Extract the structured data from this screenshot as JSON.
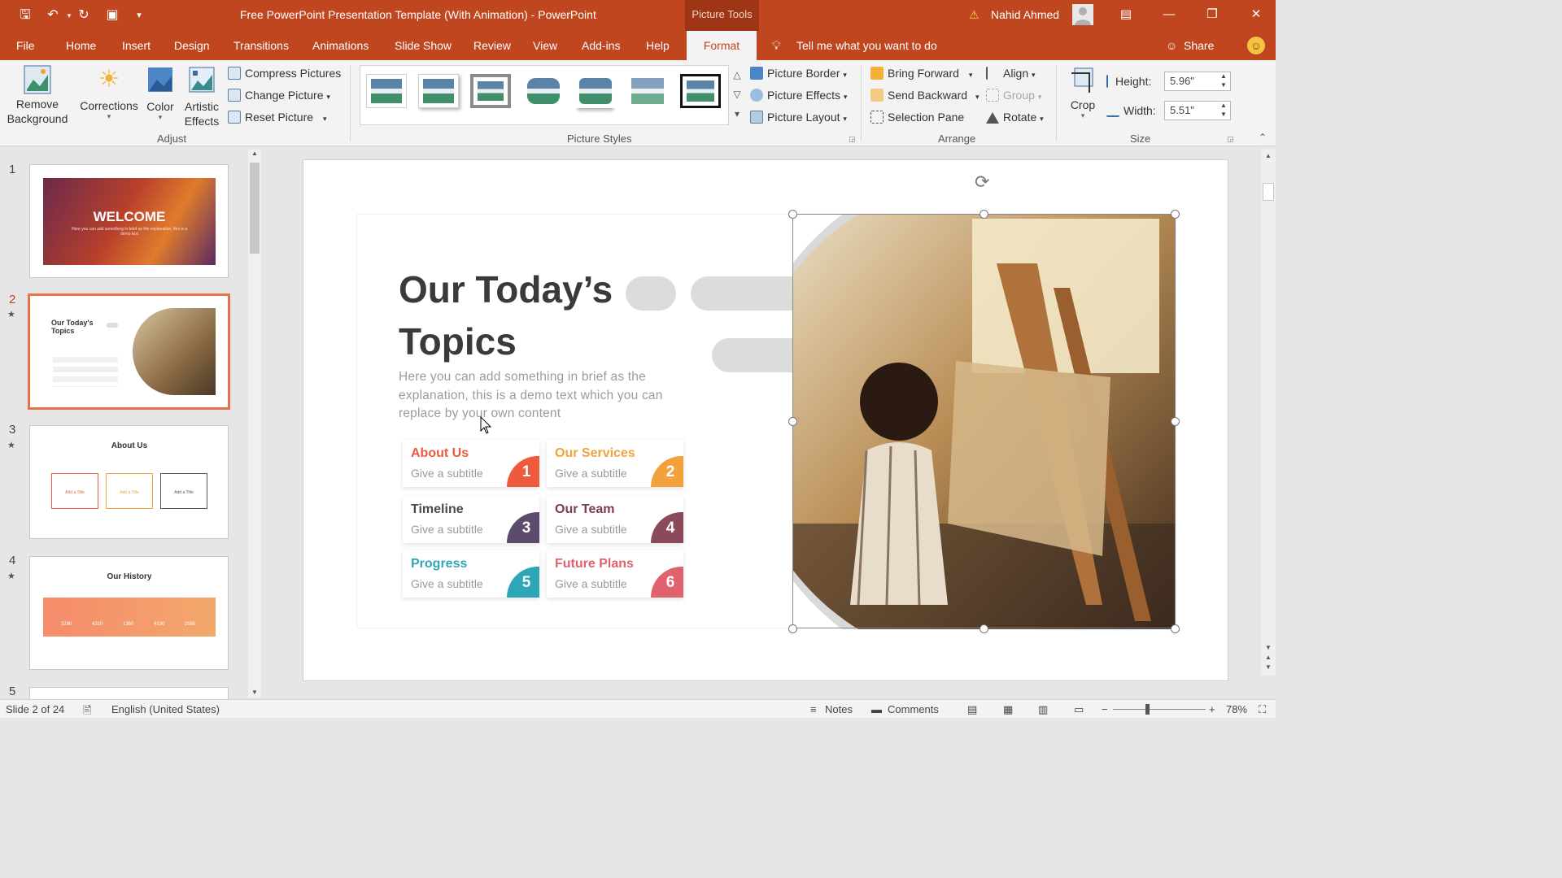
{
  "window": {
    "title": "Free PowerPoint Presentation Template (With Animation)  -  PowerPoint",
    "context_tab": "Picture Tools",
    "user": "Nahid Ahmed",
    "accent": "#c0461f"
  },
  "menu": {
    "tabs": [
      "File",
      "Home",
      "Insert",
      "Design",
      "Transitions",
      "Animations",
      "Slide Show",
      "Review",
      "View",
      "Add-ins",
      "Help"
    ],
    "active_tab": "Format",
    "tell_me": "Tell me what you want to do",
    "share": "Share"
  },
  "ribbon": {
    "adjust": {
      "remove_background": "Remove Background",
      "corrections": "Corrections",
      "color": "Color",
      "artistic_effects": "Artistic Effects",
      "compress": "Compress Pictures",
      "change": "Change Picture",
      "reset": "Reset Picture",
      "label": "Adjust"
    },
    "styles": {
      "label": "Picture Styles",
      "border": "Picture Border",
      "effects": "Picture Effects",
      "layout": "Picture Layout"
    },
    "arrange": {
      "label": "Arrange",
      "bring_forward": "Bring Forward",
      "send_backward": "Send Backward",
      "selection_pane": "Selection Pane",
      "align": "Align",
      "group": "Group",
      "rotate": "Rotate"
    },
    "size": {
      "label": "Size",
      "crop": "Crop",
      "height_label": "Height:",
      "height": "5.96\"",
      "width_label": "Width:",
      "width": "5.51\""
    }
  },
  "thumbnails": [
    {
      "num": "1",
      "text": "WELCOME",
      "sub": "Here you can add something in brief as the explanation, this is a demo text"
    },
    {
      "num": "2",
      "text": "Our Today's Topics"
    },
    {
      "num": "3",
      "text": "About Us",
      "items": [
        "Add a Title",
        "Add a Title",
        "Add a Title"
      ]
    },
    {
      "num": "4",
      "text": "Our History",
      "stats": [
        "3290",
        "4310",
        "1360",
        "4130",
        "2580"
      ]
    },
    {
      "num": "5"
    }
  ],
  "slide": {
    "title_line1": "Our Today’s",
    "title_line2": "Topics",
    "body": "Here you can add something in brief as the explanation, this is a demo text which you can replace by your own content",
    "cards": [
      {
        "title": "About Us",
        "subtitle": "Give a subtitle",
        "num": "1",
        "color": "#ef5a3c"
      },
      {
        "title": "Our Services",
        "subtitle": "Give a subtitle",
        "num": "2",
        "color": "#f3a23b"
      },
      {
        "title": "Timeline",
        "subtitle": "Give a subtitle",
        "num": "3",
        "color": "#5b4c6e"
      },
      {
        "title": "Our Team",
        "subtitle": "Give a subtitle",
        "num": "4",
        "color": "#8b4a5a"
      },
      {
        "title": "Progress",
        "subtitle": "Give a subtitle",
        "num": "5",
        "color": "#2fa6b7"
      },
      {
        "title": "Future Plans",
        "subtitle": "Give a subtitle",
        "num": "6",
        "color": "#e0626f"
      }
    ]
  },
  "status": {
    "slide_of": "Slide 2 of 24",
    "language": "English (United States)",
    "notes": "Notes",
    "comments": "Comments",
    "zoom": "78%"
  }
}
